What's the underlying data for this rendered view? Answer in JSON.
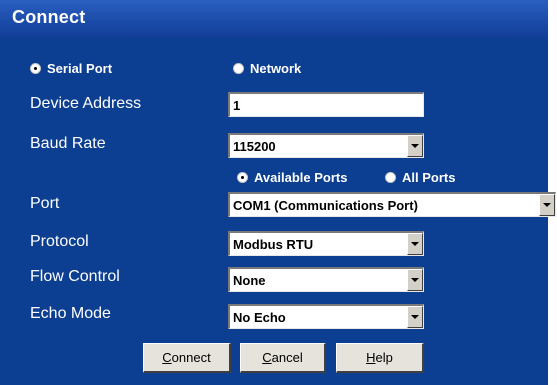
{
  "window": {
    "title": "Connect"
  },
  "connection_type": {
    "options": [
      {
        "label": "Serial Port",
        "checked": true
      },
      {
        "label": "Network",
        "checked": false
      }
    ]
  },
  "fields": {
    "device_address": {
      "label": "Device Address",
      "value": "1"
    },
    "baud_rate": {
      "label": "Baud Rate",
      "value": "115200"
    },
    "port_filter": {
      "options": [
        {
          "label": "Available Ports",
          "checked": true
        },
        {
          "label": "All Ports",
          "checked": false
        }
      ]
    },
    "port": {
      "label": "Port",
      "value": "COM1 (Communications Port)"
    },
    "protocol": {
      "label": "Protocol",
      "value": "Modbus RTU"
    },
    "flow_control": {
      "label": "Flow Control",
      "value": "None"
    },
    "echo_mode": {
      "label": "Echo Mode",
      "value": "No Echo"
    }
  },
  "buttons": {
    "connect": {
      "first": "C",
      "rest": "onnect"
    },
    "cancel": {
      "first": "C",
      "rest": "ancel"
    },
    "help": {
      "first": "H",
      "rest": "elp"
    }
  },
  "icons": {
    "dropdown": "chevron-down-icon",
    "radio": "radio-icon"
  }
}
